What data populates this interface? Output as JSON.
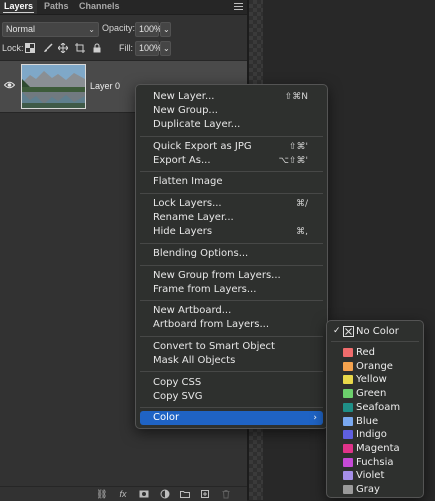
{
  "tabs": [
    "Layers",
    "Paths",
    "Channels"
  ],
  "blend_mode": "Normal",
  "opacity": {
    "label": "Opacity:",
    "value": "100%"
  },
  "lock": {
    "label": "Lock:"
  },
  "fill": {
    "label": "Fill:",
    "value": "100%"
  },
  "layer": {
    "name": "Layer 0"
  },
  "context_menu": {
    "items": [
      {
        "label": "New Layer...",
        "shortcut": "⇧⌘N"
      },
      {
        "label": "New Group...",
        "shortcut": ""
      },
      {
        "label": "Duplicate Layer...",
        "shortcut": ""
      },
      {
        "label": "Quick Export as JPG",
        "shortcut": "⇧⌘'"
      },
      {
        "label": "Export As...",
        "shortcut": "⌥⇧⌘'"
      },
      {
        "label": "Flatten Image",
        "shortcut": ""
      },
      {
        "label": "Lock Layers...",
        "shortcut": "⌘/"
      },
      {
        "label": "Rename Layer...",
        "shortcut": ""
      },
      {
        "label": "Hide Layers",
        "shortcut": "⌘,"
      },
      {
        "label": "Blending Options...",
        "shortcut": ""
      },
      {
        "label": "New Group from Layers...",
        "shortcut": ""
      },
      {
        "label": "Frame from Layers...",
        "shortcut": ""
      },
      {
        "label": "New Artboard...",
        "shortcut": ""
      },
      {
        "label": "Artboard from Layers...",
        "shortcut": ""
      },
      {
        "label": "Convert to Smart Object",
        "shortcut": ""
      },
      {
        "label": "Mask All Objects",
        "shortcut": ""
      },
      {
        "label": "Copy CSS",
        "shortcut": ""
      },
      {
        "label": "Copy SVG",
        "shortcut": ""
      },
      {
        "label": "Color",
        "shortcut": ""
      }
    ]
  },
  "color_menu": {
    "checked": "✓",
    "items": [
      {
        "label": "No Color",
        "color": ""
      },
      {
        "label": "Red",
        "color": "#f06c6c"
      },
      {
        "label": "Orange",
        "color": "#f5a34e"
      },
      {
        "label": "Yellow",
        "color": "#e8d84a"
      },
      {
        "label": "Green",
        "color": "#6ccf6c"
      },
      {
        "label": "Seafoam",
        "color": "#1f8f87"
      },
      {
        "label": "Blue",
        "color": "#7aa9f0"
      },
      {
        "label": "Indigo",
        "color": "#5f5fe0"
      },
      {
        "label": "Magenta",
        "color": "#e0338a"
      },
      {
        "label": "Fuchsia",
        "color": "#c64ad6"
      },
      {
        "label": "Violet",
        "color": "#a58fe8"
      },
      {
        "label": "Gray",
        "color": "#9a9a9a"
      }
    ]
  },
  "colors": {
    "highlight": "#1f63c4",
    "panel": "#323232",
    "menu": "#2e302e"
  }
}
